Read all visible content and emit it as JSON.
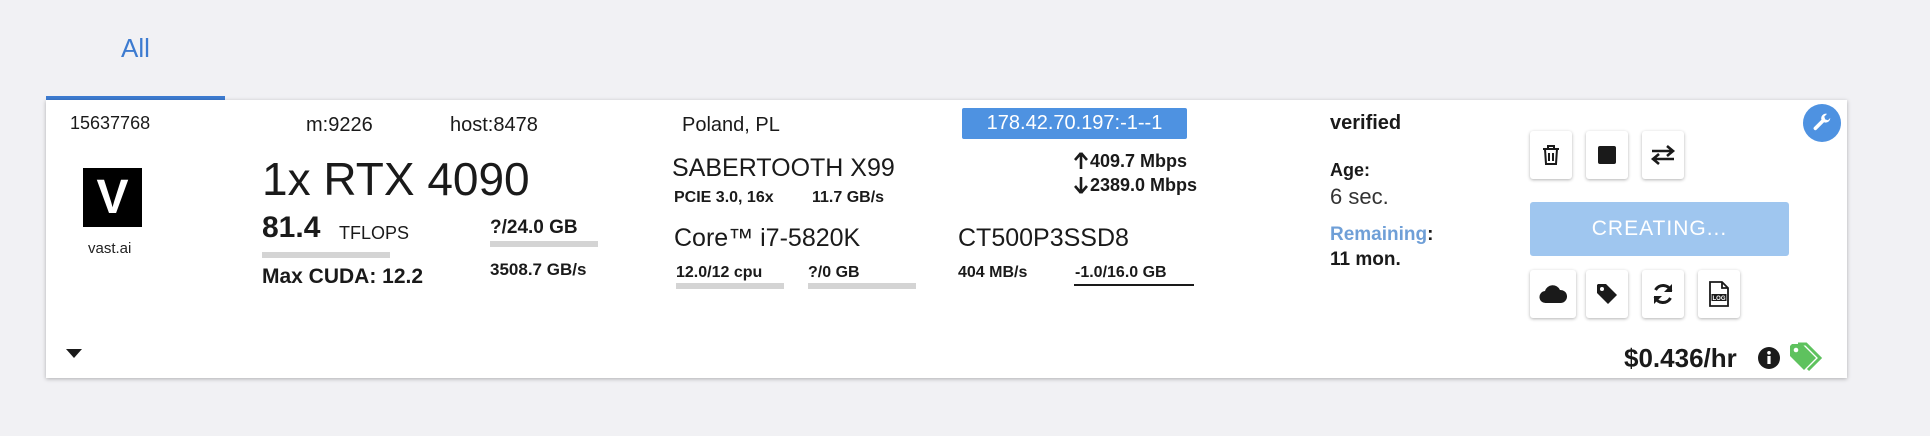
{
  "tabs": [
    {
      "label": "All",
      "active": true
    }
  ],
  "instance": {
    "id": "15637768",
    "machine": "m:9226",
    "host": "host:8478",
    "location": "Poland, PL",
    "logo_letter": "V",
    "logo_caption": "vast.ai",
    "gpu": {
      "name": "1x RTX 4090",
      "tflops_value": "81.4",
      "tflops_unit": "TFLOPS",
      "max_cuda": "Max CUDA: 12.2",
      "vram": "?/24.0 GB",
      "bandwidth": "3508.7 GB/s"
    },
    "motherboard": {
      "name": "SABERTOOTH X99",
      "pcie": "PCIE 3.0, 16x",
      "pcie_bw": "11.7 GB/s"
    },
    "cpu": {
      "name": "Core™ i7-5820K",
      "cores": "12.0/12 cpu",
      "ram": "?/0 GB"
    },
    "storage": {
      "name": "CT500P3SSD8",
      "speed": "404 MB/s",
      "usage": "-1.0/16.0 GB"
    },
    "network": {
      "ip": "178.42.70.197:-1--1",
      "upload": "409.7 Mbps",
      "download": "2389.0 Mbps"
    },
    "status": {
      "verification": "verified",
      "age_label": "Age:",
      "age_value": "6 sec.",
      "remaining_label": "Remaining",
      "remaining_colon": ":",
      "remaining_value": "11 mon."
    },
    "action": {
      "creating_label": "CREATING..."
    },
    "price": "$0.436/hr"
  },
  "colors": {
    "accent": "#4e92e1",
    "tab_active": "#3d7bd0",
    "creating_bg": "#9fc6ef",
    "tag_green": "#5ec25e",
    "remaining_label": "#6f9fd7"
  },
  "icons": [
    "trash-icon",
    "stop-icon",
    "swap-icon",
    "cloud-icon",
    "tag-icon",
    "refresh-icon",
    "log-icon",
    "wrench-icon",
    "info-icon",
    "price-tag-icon",
    "expand-arrow-icon",
    "arrow-up-icon",
    "arrow-down-icon"
  ]
}
